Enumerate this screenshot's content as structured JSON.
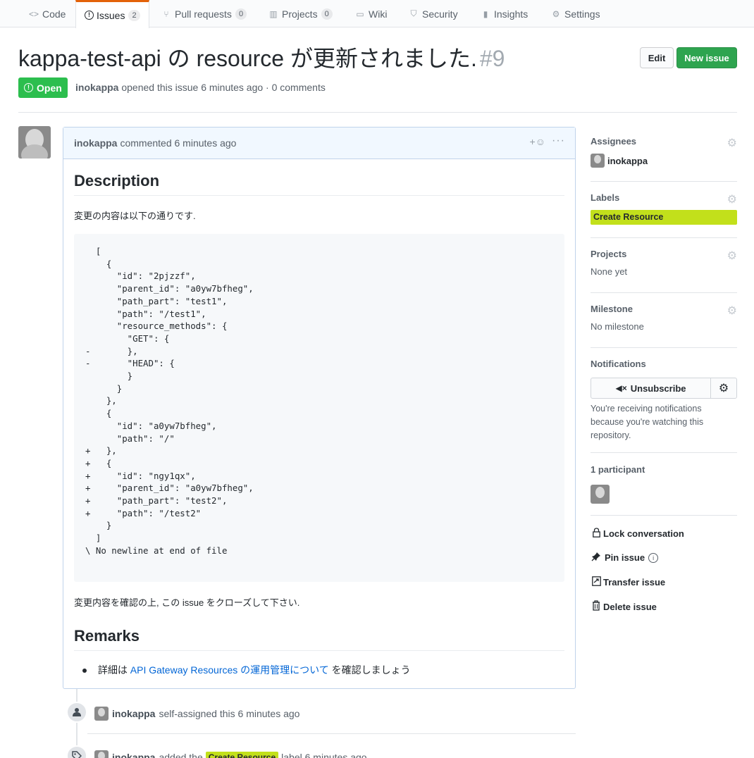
{
  "tabs": [
    {
      "label": "Code",
      "icon": "code-icon",
      "glyph": "<>"
    },
    {
      "label": "Issues",
      "icon": "issue-opened-icon",
      "glyph": "!",
      "count": "2"
    },
    {
      "label": "Pull requests",
      "icon": "git-pull-request-icon",
      "glyph": "⑂",
      "count": "0"
    },
    {
      "label": "Projects",
      "icon": "project-icon",
      "glyph": "▥",
      "count": "0"
    },
    {
      "label": "Wiki",
      "icon": "book-icon",
      "glyph": "▭"
    },
    {
      "label": "Security",
      "icon": "shield-icon",
      "glyph": "⛉"
    },
    {
      "label": "Insights",
      "icon": "graph-icon",
      "glyph": "▮"
    },
    {
      "label": "Settings",
      "icon": "gear-icon",
      "glyph": "⚙"
    }
  ],
  "issue": {
    "title": "kappa-test-api の resource が更新されました.",
    "number": "#9",
    "state": "Open",
    "author": "inokappa",
    "meta_text": "opened this issue 6 minutes ago · 0 comments",
    "edit_label": "Edit",
    "new_issue_label": "New issue"
  },
  "comment": {
    "author": "inokappa",
    "time": "commented 6 minutes ago",
    "reaction_glyph": "+☺",
    "more_glyph": "···",
    "heading1": "Description",
    "para1": "変更の内容は以下の通りです.",
    "code": "  [\n    {\n      \"id\": \"2pjzzf\",\n      \"parent_id\": \"a0yw7bfheg\",\n      \"path_part\": \"test1\",\n      \"path\": \"/test1\",\n      \"resource_methods\": {\n        \"GET\": {\n-       },\n-       \"HEAD\": {\n        }\n      }\n    },\n    {\n      \"id\": \"a0yw7bfheg\",\n      \"path\": \"/\"\n+   },\n+   {\n+     \"id\": \"ngy1qx\",\n+     \"parent_id\": \"a0yw7bfheg\",\n+     \"path_part\": \"test2\",\n+     \"path\": \"/test2\"\n    }\n  ]\n\\ No newline at end of file",
    "para2": "変更内容を確認の上, この issue をクローズして下さい.",
    "heading2": "Remarks",
    "bullet_prefix": "詳細は",
    "bullet_link": "API Gateway Resources の運用管理について",
    "bullet_suffix": "を確認しましょう"
  },
  "timeline": [
    {
      "actor": "inokappa",
      "text": "self-assigned this 6 minutes ago"
    },
    {
      "actor": "inokappa",
      "text_before": "added the",
      "label": "Create Resource",
      "text_after": "label 6 minutes ago"
    }
  ],
  "sidebar": {
    "assignees_title": "Assignees",
    "assignee": "inokappa",
    "labels_title": "Labels",
    "label": "Create Resource",
    "label_color": "#c2e01b",
    "projects_title": "Projects",
    "projects_value": "None yet",
    "milestone_title": "Milestone",
    "milestone_value": "No milestone",
    "notifications_title": "Notifications",
    "unsubscribe_label": "Unsubscribe",
    "notice": "You're receiving notifications because you're watching this repository.",
    "participants_title": "1 participant",
    "lock": "Lock conversation",
    "pin": "Pin issue",
    "transfer": "Transfer issue",
    "delete": "Delete issue"
  }
}
